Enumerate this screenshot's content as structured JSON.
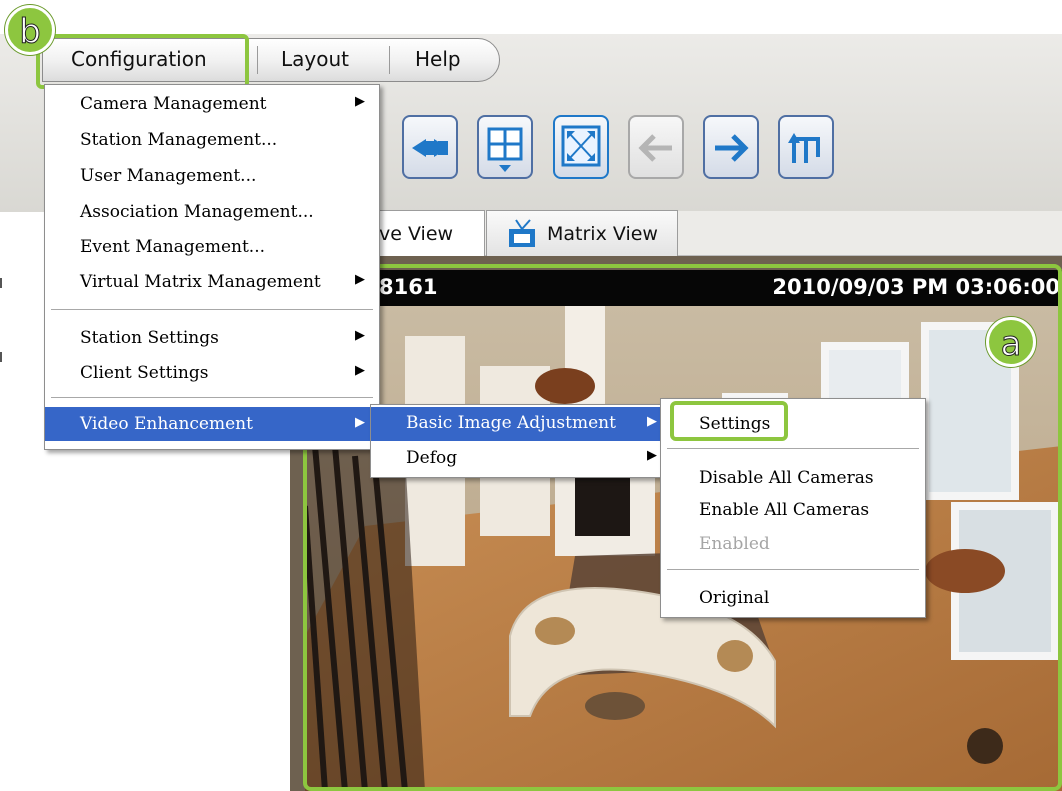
{
  "menubar": {
    "items": [
      "Configuration",
      "Layout",
      "Help"
    ]
  },
  "tabs": {
    "live": "ve View",
    "matrix": "Matrix View"
  },
  "video": {
    "camera": "8161",
    "timestamp": "2010/09/03 PM 03:06:00"
  },
  "badges": {
    "a": "a",
    "b": "b"
  },
  "config_menu": {
    "items": [
      {
        "label": "Camera Management",
        "submenu": true
      },
      {
        "label": "Station Management...",
        "submenu": false
      },
      {
        "label": "User Management...",
        "submenu": false
      },
      {
        "label": "Association Management...",
        "submenu": false
      },
      {
        "label": "Event Management...",
        "submenu": false
      },
      {
        "label": "Virtual Matrix Management",
        "submenu": true
      },
      {
        "label": "Station Settings",
        "submenu": true
      },
      {
        "label": "Client Settings",
        "submenu": true
      },
      {
        "label": "Video Enhancement",
        "submenu": true,
        "active": true
      }
    ]
  },
  "video_enhancement_menu": {
    "items": [
      {
        "label": "Basic Image Adjustment",
        "submenu": true,
        "active": true
      },
      {
        "label": "Defog",
        "submenu": true
      }
    ]
  },
  "basic_image_menu": {
    "items": [
      {
        "label": "Settings"
      },
      {
        "label": "Disable All Cameras"
      },
      {
        "label": "Enable All Cameras"
      },
      {
        "label": "Enabled",
        "disabled": true
      },
      {
        "label": "Original"
      }
    ]
  },
  "colors": {
    "highlight_green": "#8dc63f",
    "menu_active": "#3666c8",
    "toolbar_button_border": "#4f6fa3"
  },
  "icons": [
    "camera-swap-icon",
    "grid-layout-icon",
    "fullscreen-icon",
    "back-arrow-icon",
    "forward-arrow-icon",
    "rotate-icon",
    "tv-icon",
    "submenu-arrow-icon"
  ]
}
